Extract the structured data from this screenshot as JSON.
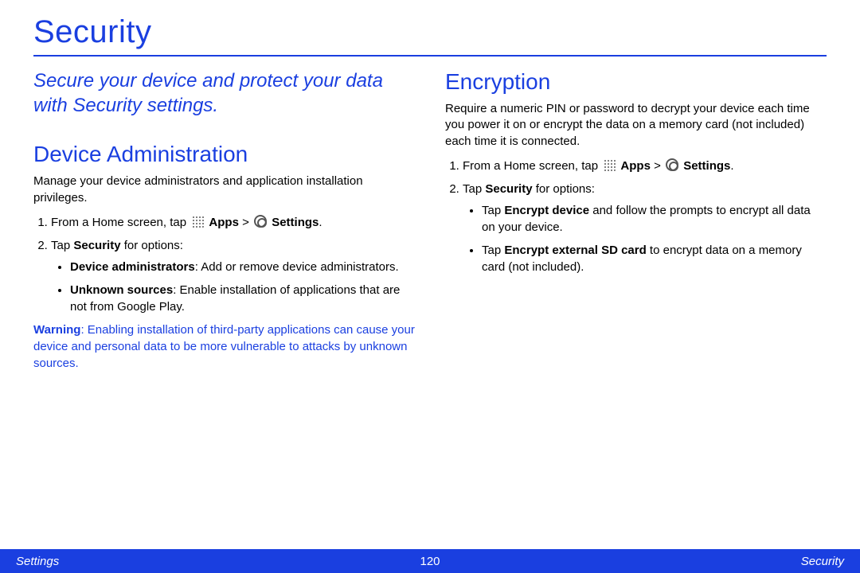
{
  "title": "Security",
  "subtitle": "Secure your device and protect your data with Security settings.",
  "deviceAdmin": {
    "heading": "Device Administration",
    "intro": "Manage your device administrators and application installation privileges.",
    "step1_pre": "From a Home screen, tap ",
    "step1_apps": "Apps",
    "step1_gt": " > ",
    "step1_settings": "Settings",
    "step1_post": ".",
    "step2_pre": "Tap ",
    "step2_b": "Security",
    "step2_post": " for options:",
    "b1_b": "Device administrators",
    "b1_rest": ": Add or remove device administrators.",
    "b2_b": "Unknown sources",
    "b2_rest": ": Enable installation of applications that are not from Google Play.",
    "warn_b": "Warning",
    "warn_rest": ": Enabling installation of third-party applications can cause your device and personal data to be more vulnerable to attacks by unknown sources."
  },
  "encryption": {
    "heading": "Encryption",
    "intro": "Require a numeric PIN or password to decrypt your device each time you power it on or encrypt the data on a memory card (not included) each time it is connected.",
    "step1_pre": "From a Home screen, tap ",
    "step1_apps": "Apps",
    "step1_gt": " > ",
    "step1_settings": "Settings",
    "step1_post": ".",
    "step2_pre": "Tap ",
    "step2_b": "Security",
    "step2_post": " for options:",
    "b1_pre": "Tap ",
    "b1_b": "Encrypt device",
    "b1_post": " and follow the prompts to encrypt all data on your device.",
    "b2_pre": "Tap ",
    "b2_b": "Encrypt external SD card",
    "b2_post": " to encrypt data on a memory card (not included)."
  },
  "footer": {
    "left": "Settings",
    "center": "120",
    "right": "Security"
  }
}
